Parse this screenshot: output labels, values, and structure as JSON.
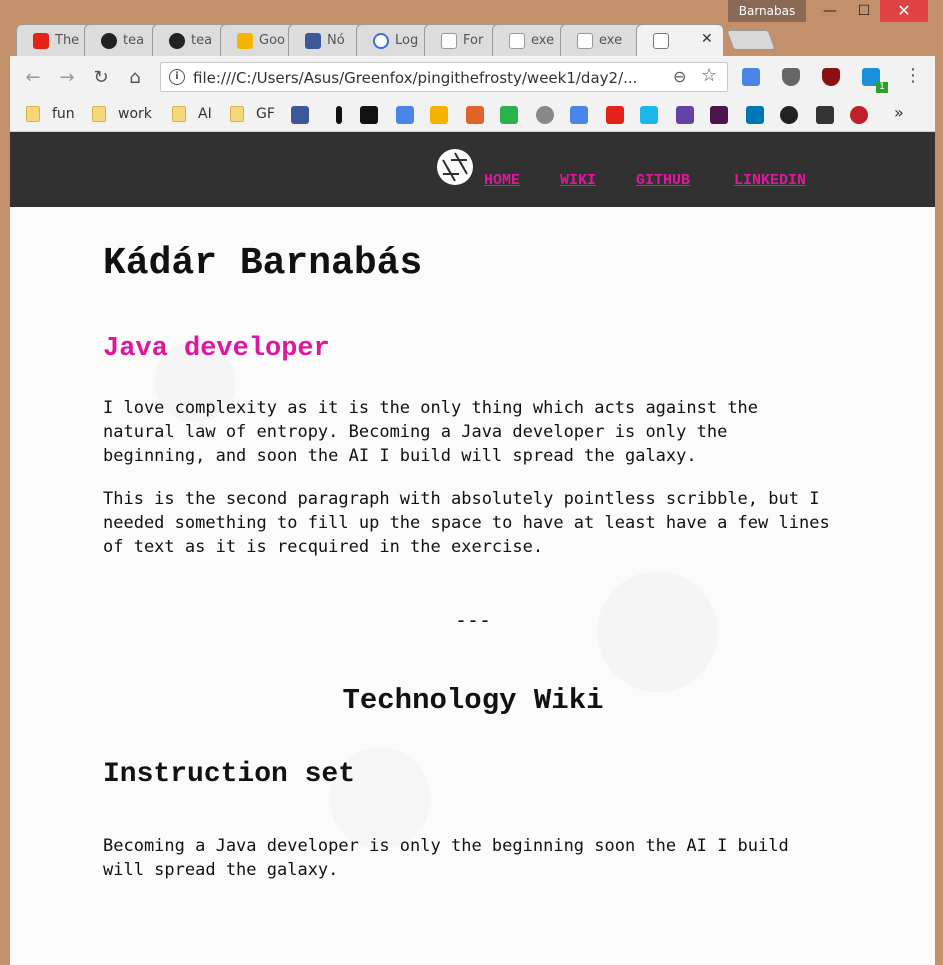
{
  "window": {
    "profile_name": "Barnabas",
    "minimize": "—",
    "maximize": "☐",
    "close": "✕"
  },
  "tabs": [
    {
      "label": "The",
      "icon": "youtube-icon",
      "color": "#e62117"
    },
    {
      "label": "tea",
      "icon": "github-icon",
      "color": "#222222"
    },
    {
      "label": "tea",
      "icon": "github-icon",
      "color": "#222222"
    },
    {
      "label": "Goo",
      "icon": "keep-icon",
      "color": "#f6b400"
    },
    {
      "label": "Nó",
      "icon": "facebook-icon",
      "color": "#3b5998"
    },
    {
      "label": "Log",
      "icon": "circle-icon",
      "color": "#3a6fd8"
    },
    {
      "label": "For",
      "icon": "page-icon",
      "color": "#9a9a9a"
    },
    {
      "label": "exe",
      "icon": "page-icon",
      "color": "#9a9a9a"
    },
    {
      "label": "exe",
      "icon": "page-icon",
      "color": "#9a9a9a"
    }
  ],
  "active_tab": {
    "icon": "page-icon",
    "close": "✕"
  },
  "toolbar": {
    "url": "file:///C:/Users/Asus/Greenfox/pingithefrosty/week1/day2/...",
    "back": "←",
    "forward": "→",
    "reload": "↻",
    "home": "⌂",
    "info": "i",
    "zoom": "⊖",
    "star": "☆",
    "extension_badge": "1",
    "menu": "⋮"
  },
  "bookmarks": {
    "folders": [
      "fun",
      "work",
      "AI",
      "GF"
    ],
    "icons": [
      {
        "name": "facebook-icon",
        "color": "#3b5998"
      },
      {
        "name": "instapaper-icon",
        "color": "#111111"
      },
      {
        "name": "4chan-icon",
        "color": "#111111"
      },
      {
        "name": "mail-icon",
        "color": "#4a86e8"
      },
      {
        "name": "keep-icon",
        "color": "#f6b400"
      },
      {
        "name": "hacker-icon",
        "color": "#e0632a"
      },
      {
        "name": "feedly-icon",
        "color": "#2bb24c"
      },
      {
        "name": "reddit-icon",
        "color": "#888888"
      },
      {
        "name": "calendar-icon",
        "color": "#4a86e8"
      },
      {
        "name": "youtube-icon",
        "color": "#e62117"
      },
      {
        "name": "vimeo-icon",
        "color": "#1ab7ea"
      },
      {
        "name": "twitch-icon",
        "color": "#6441a5"
      },
      {
        "name": "slack-icon",
        "color": "#4a154b"
      },
      {
        "name": "linkedin-icon",
        "color": "#0077b5"
      },
      {
        "name": "steam-icon",
        "color": "#222222"
      },
      {
        "name": "codeship-icon",
        "color": "#333333"
      },
      {
        "name": "game-icon",
        "color": "#c0202a"
      }
    ],
    "more": "»"
  },
  "site": {
    "nav": [
      "HOME",
      "WIKI",
      "GITHUB",
      "LINKEDIN"
    ],
    "accent_color": "#e0179c",
    "name": "Kádár Barnabás",
    "role": "Java developer",
    "paragraph1": "I love complexity as it is the only thing which acts against the natural law of entropy. Becoming a Java developer is only the beginning, and soon the AI I build will spread the galaxy.",
    "paragraph2": "This is the second paragraph with absolutely pointless scribble, but I needed something to fill up the space to have at least have a few lines of text as it is recquired in the exercise.",
    "separator": "---",
    "wiki_title": "Technology Wiki",
    "section_title": "Instruction set",
    "paragraph3": "Becoming a Java developer is only the beginning soon the AI I build will spread the galaxy."
  }
}
